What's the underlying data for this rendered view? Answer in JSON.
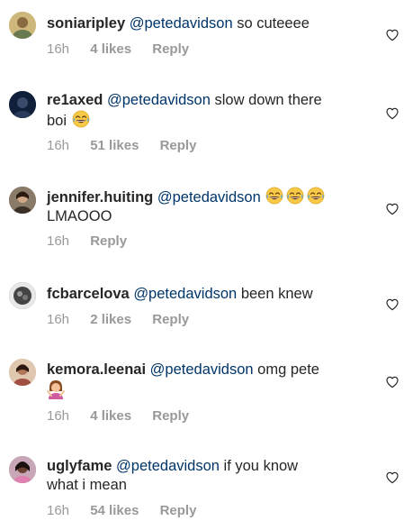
{
  "comments": [
    {
      "username": "soniaripley",
      "mention": "@petedavidson",
      "text": "so cuteeee",
      "time": "16h",
      "likes": "4 likes",
      "reply": "Reply",
      "avatar_color": "#c8b070"
    },
    {
      "username": "re1axed",
      "mention": "@petedavidson",
      "text": "slow down there",
      "text2": "boi",
      "emoji_count": 1,
      "time": "16h",
      "likes": "51 likes",
      "reply": "Reply",
      "avatar_color": "#1a2a44"
    },
    {
      "username": "jennifer.huiting",
      "mention": "@petedavidson",
      "text": "",
      "text2": "LMAOOO",
      "emoji_count": 3,
      "time": "16h",
      "reply": "Reply",
      "avatar_color": "#7a6a5a"
    },
    {
      "username": "fcbarcelova",
      "mention": "@petedavidson",
      "text": "been knew",
      "time": "16h",
      "likes": "2 likes",
      "reply": "Reply",
      "avatar_color": "#555555"
    },
    {
      "username": "kemora.leenai",
      "mention": "@petedavidson",
      "text": "omg pete",
      "emoji_line2": "woman-gesturing-emoji",
      "time": "16h",
      "likes": "4 likes",
      "reply": "Reply",
      "avatar_color": "#c89a80"
    },
    {
      "username": "uglyfame",
      "mention": "@petedavidson",
      "text": "if you know",
      "text2": "what i mean",
      "time": "16h",
      "likes": "54 likes",
      "reply": "Reply",
      "avatar_color": "#8a6a7a"
    }
  ],
  "colors": {
    "mention": "#003569",
    "meta": "#999999",
    "text": "#262626"
  },
  "icons": {
    "like": "heart-outline-icon",
    "laugh": "face-with-tears-of-joy-emoji"
  }
}
